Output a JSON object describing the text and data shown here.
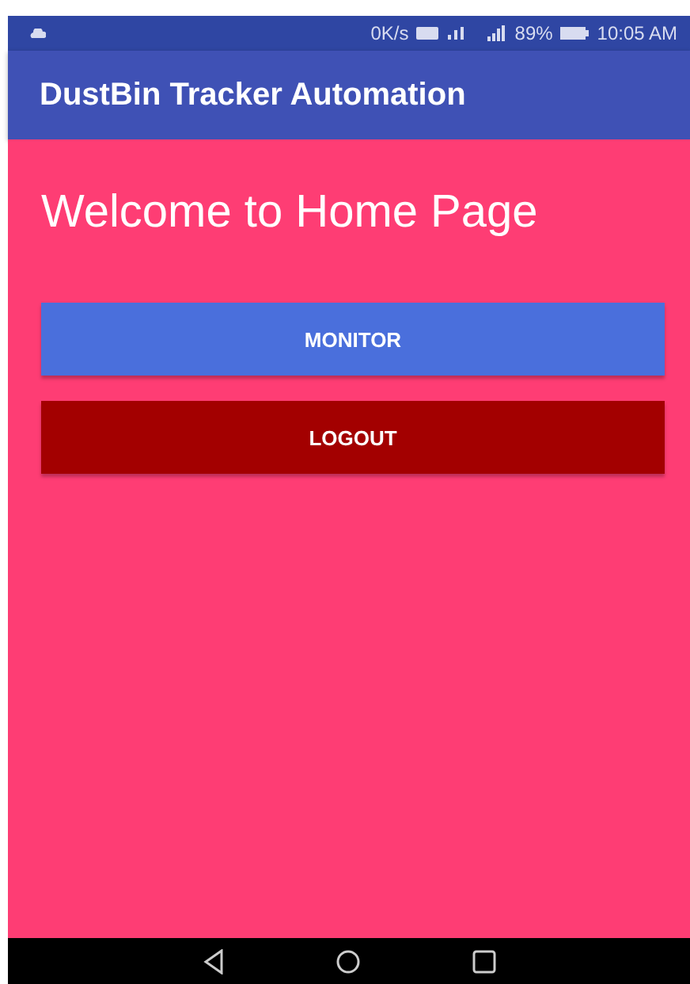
{
  "status_bar": {
    "speed": "0K/s",
    "battery": "89%",
    "time": "10:05 AM"
  },
  "app_bar": {
    "title": "DustBin Tracker Automation"
  },
  "heading": "Welcome to Home Page",
  "buttons": [
    {
      "label": "MONITOR",
      "kind": "primary"
    },
    {
      "label": "LOGOUT",
      "kind": "danger"
    }
  ]
}
